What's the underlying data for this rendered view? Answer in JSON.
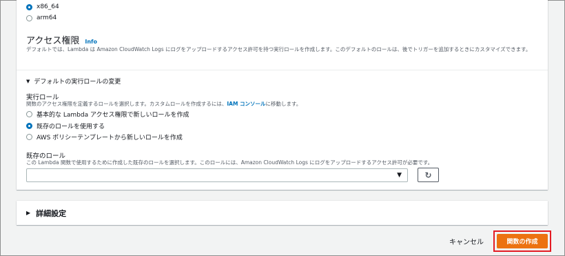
{
  "architecture": {
    "options": [
      {
        "label": "x86_64",
        "checked": true
      },
      {
        "label": "arm64",
        "checked": false
      }
    ]
  },
  "permissions": {
    "title": "アクセス権限",
    "info": "Info",
    "description": "デフォルトでは、Lambda は Amazon CloudWatch Logs にログをアップロードするアクセス許可を持つ実行ロールを作成します。このデフォルトのロールは、後でトリガーを追加するときにカスタマイズできます。"
  },
  "execution_role": {
    "expander_label": "デフォルトの実行ロールの変更",
    "label": "実行ロール",
    "description_prefix": "関数のアクセス権限を定義するロールを選択します。カスタムロールを作成するには、",
    "iam_link": "IAM コンソール",
    "description_suffix": "に移動します。",
    "options": [
      {
        "label": "基本的な Lambda アクセス権限で新しいロールを作成",
        "checked": false
      },
      {
        "label": "既存のロールを使用する",
        "checked": true
      },
      {
        "label": "AWS ポリシーテンプレートから新しいロールを作成",
        "checked": false
      }
    ]
  },
  "existing_role": {
    "label": "既存のロール",
    "description": "この Lambda 関数で使用するために作成した既存のロールを選択します。このロールには、Amazon CloudWatch Logs にログをアップロードするアクセス許可が必要です。",
    "value": "",
    "caret_icon": "caret-down-icon",
    "refresh_icon": "refresh-icon"
  },
  "advanced": {
    "label": "詳細設定"
  },
  "footer": {
    "cancel_label": "キャンセル",
    "create_label": "関数の作成"
  },
  "colors": {
    "primary_button": "#ec7211",
    "link": "#0073bb",
    "highlight_border": "#e41b23"
  }
}
